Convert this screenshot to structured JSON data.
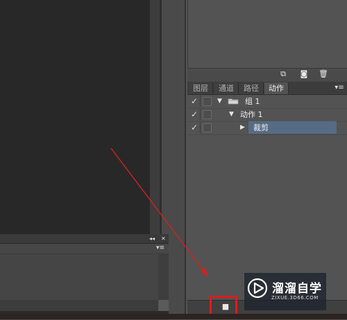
{
  "actions_panel": {
    "tabs": [
      {
        "label": "图层",
        "active": false
      },
      {
        "label": "通道",
        "active": false
      },
      {
        "label": "路径",
        "active": false
      },
      {
        "label": "动作",
        "active": true
      }
    ],
    "rows": [
      {
        "checked": true,
        "label": "组 1",
        "expanded": true,
        "type": "set"
      },
      {
        "checked": true,
        "label": "动作 1",
        "expanded": true,
        "type": "action"
      },
      {
        "checked": true,
        "label": "裁剪",
        "expanded": false,
        "type": "step",
        "selected": true
      }
    ],
    "toolbar_icons": [
      "new-layer-icon",
      "camera-icon",
      "trash-icon"
    ],
    "bottom_controls": [
      "stop-icon"
    ]
  },
  "watermark": {
    "text": "溜溜自学",
    "url": "ZIXUE.3D66.COM"
  },
  "colors": {
    "highlight": "#e01b1b",
    "selection": "#566b85",
    "arrow": "#d42020"
  }
}
